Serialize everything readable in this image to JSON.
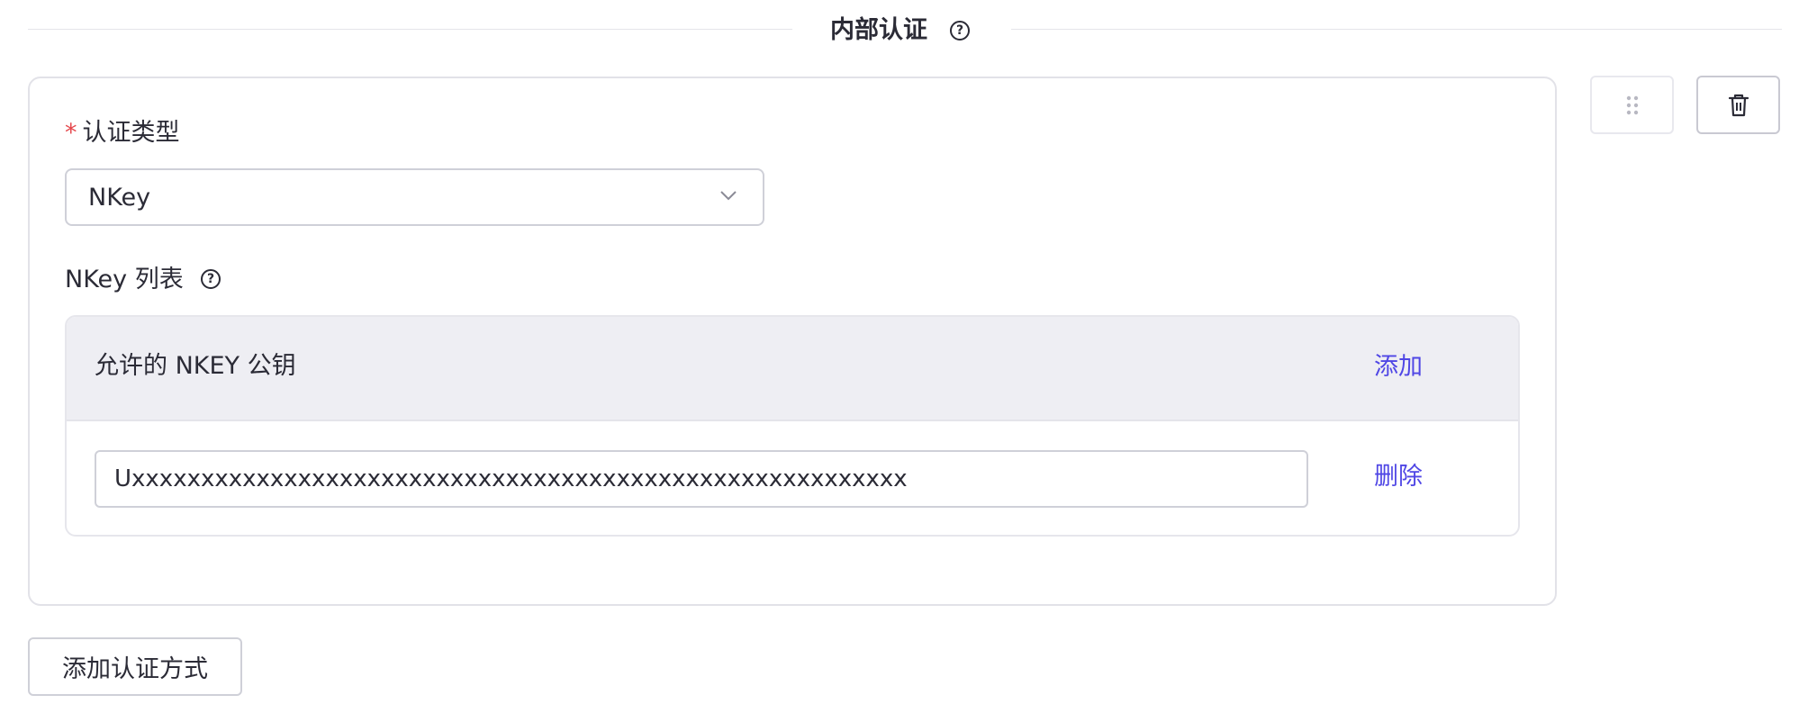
{
  "section": {
    "title": "内部认证",
    "help_icon": "question-circle-icon"
  },
  "auth_type": {
    "required_mark": "*",
    "label": "认证类型",
    "selected": "NKey",
    "dropdown_icon": "chevron-down-icon"
  },
  "nkey_list": {
    "label": "NKey 列表",
    "help_icon": "question-circle-icon",
    "header_title": "允许的 NKEY 公钥",
    "add_label": "添加",
    "rows": [
      {
        "value": "Uxxxxxxxxxxxxxxxxxxxxxxxxxxxxxxxxxxxxxxxxxxxxxxxxxxxxxxxx",
        "delete_label": "删除"
      }
    ]
  },
  "toolbar": {
    "drag_icon": "drag-handle-icon",
    "delete_icon": "trash-icon"
  },
  "add_method_label": "添加认证方式",
  "colors": {
    "link": "#4f46e5",
    "required": "#e5484d",
    "header_bg": "#eeeef3",
    "text": "#2b2b36"
  }
}
